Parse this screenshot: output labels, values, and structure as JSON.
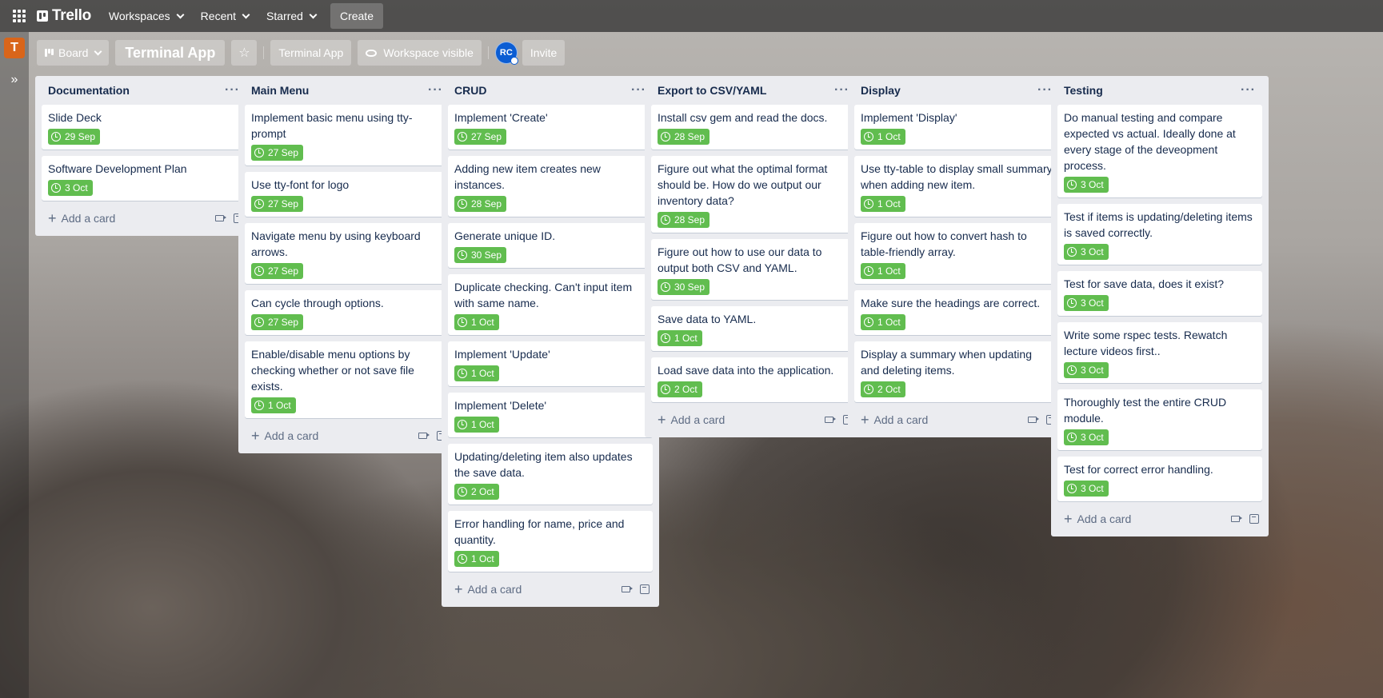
{
  "header": {
    "app_name": "Trello",
    "nav": [
      "Workspaces",
      "Recent",
      "Starred"
    ],
    "create_label": "Create"
  },
  "sidebar": {
    "workspace_letter": "T",
    "expand_glyph": "»"
  },
  "board": {
    "view_label": "Board",
    "title": "Terminal App",
    "workspace_button": "Terminal App",
    "visibility": "Workspace visible",
    "member_initials": "RC",
    "invite_label": "Invite"
  },
  "add_card_label": "Add a card",
  "colors": {
    "label_green": "#61bd4f",
    "list_bg": "#ebecf0",
    "workspace_orange": "#d9651a",
    "avatar_blue": "#0b5dd3"
  },
  "lists": [
    {
      "title": "Documentation",
      "cards": [
        {
          "title": "Slide Deck",
          "due": "29 Sep"
        },
        {
          "title": "Software Development Plan",
          "due": "3 Oct"
        }
      ]
    },
    {
      "title": "Main Menu",
      "cards": [
        {
          "title": "Implement basic menu using tty-prompt",
          "due": "27 Sep"
        },
        {
          "title": "Use tty-font for logo",
          "due": "27 Sep"
        },
        {
          "title": "Navigate menu by using keyboard arrows.",
          "due": "27 Sep"
        },
        {
          "title": "Can cycle through options.",
          "due": "27 Sep"
        },
        {
          "title": "Enable/disable menu options by checking whether or not save file exists.",
          "due": "1 Oct"
        }
      ]
    },
    {
      "title": "CRUD",
      "cards": [
        {
          "title": "Implement 'Create'",
          "due": "27 Sep"
        },
        {
          "title": "Adding new item creates new instances.",
          "due": "28 Sep"
        },
        {
          "title": "Generate unique ID.",
          "due": "30 Sep"
        },
        {
          "title": "Duplicate checking. Can't input item with same name.",
          "due": "1 Oct"
        },
        {
          "title": "Implement 'Update'",
          "due": "1 Oct"
        },
        {
          "title": "Implement 'Delete'",
          "due": "1 Oct"
        },
        {
          "title": "Updating/deleting item also updates the save data.",
          "due": "2 Oct"
        },
        {
          "title": "Error handling for name, price and quantity.",
          "due": "1 Oct"
        }
      ]
    },
    {
      "title": "Export to CSV/YAML",
      "cards": [
        {
          "title": "Install csv gem and read the docs.",
          "due": "28 Sep"
        },
        {
          "title": "Figure out what the optimal format should be. How do we output our inventory data?",
          "due": "28 Sep"
        },
        {
          "title": "Figure out how to use our data to output both CSV and YAML.",
          "due": "30 Sep"
        },
        {
          "title": "Save data to YAML.",
          "due": "1 Oct"
        },
        {
          "title": "Load save data into the application.",
          "due": "2 Oct"
        }
      ]
    },
    {
      "title": "Display",
      "cards": [
        {
          "title": "Implement 'Display'",
          "due": "1 Oct"
        },
        {
          "title": "Use tty-table to display small summary when adding new item.",
          "due": "1 Oct"
        },
        {
          "title": "Figure out how to convert hash to table-friendly array.",
          "due": "1 Oct"
        },
        {
          "title": "Make sure the headings are correct.",
          "due": "1 Oct"
        },
        {
          "title": "Display a summary when updating and deleting items.",
          "due": "2 Oct"
        }
      ]
    },
    {
      "title": "Testing",
      "cards": [
        {
          "title": "Do manual testing and compare expected vs actual. Ideally done at every stage of the deveopment process.",
          "due": "3 Oct"
        },
        {
          "title": "Test if items is updating/deleting items is saved correctly.",
          "due": "3 Oct"
        },
        {
          "title": "Test for save data, does it exist?",
          "due": "3 Oct"
        },
        {
          "title": "Write some rspec tests. Rewatch lecture videos first..",
          "due": "3 Oct"
        },
        {
          "title": "Thoroughly test the entire CRUD module.",
          "due": "3 Oct"
        },
        {
          "title": "Test for correct error handling.",
          "due": "3 Oct"
        }
      ]
    }
  ]
}
